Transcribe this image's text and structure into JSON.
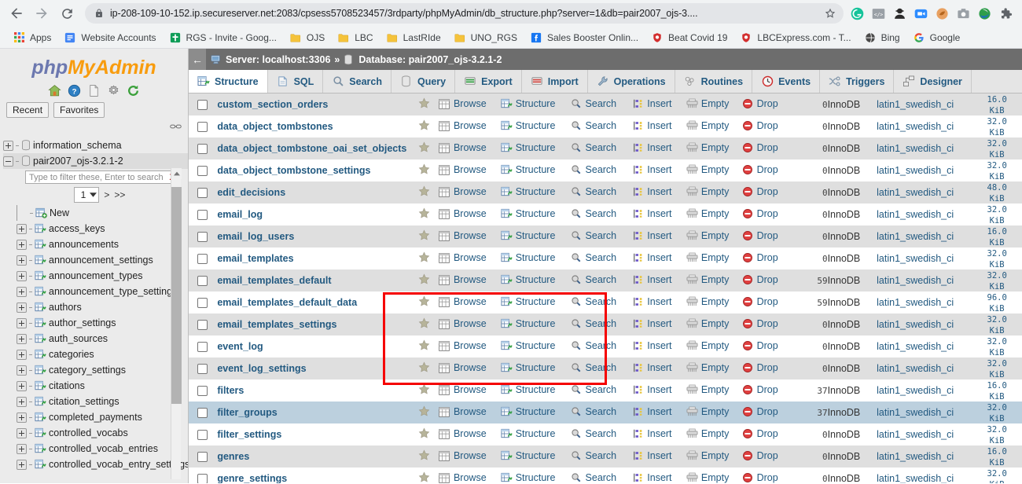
{
  "browser": {
    "nav": {
      "back_icon": "arrow-left-icon",
      "forward_icon": "arrow-right-icon",
      "reload_icon": "reload-icon",
      "lock_icon": "lock-icon",
      "url": "ip-208-109-10-152.ip.secureserver.net:2083/cpsess5708523457/3rdparty/phpMyAdmin/db_structure.php?server=1&db=pair2007_ojs-3....",
      "star_icon": "star-outline-icon"
    },
    "extensions": [
      {
        "name": "grammarly-extension-icon",
        "glyph": "G",
        "color": "#15c39a",
        "shape": "circle"
      },
      {
        "name": "code-extension-icon",
        "glyph": "</>",
        "color": "#9aa0a6",
        "shape": "square"
      },
      {
        "name": "incognito-person-icon",
        "glyph": "♟",
        "color": "#2b2b2b",
        "shape": "none"
      },
      {
        "name": "zoom-extension-icon",
        "glyph": "▶",
        "color": "#2d8cff",
        "shape": "rounded"
      },
      {
        "name": "kiwi-browser-icon",
        "glyph": "●",
        "color": "#e08a3c",
        "shape": "circle"
      },
      {
        "name": "screenshot-camera-icon",
        "glyph": "◎",
        "color": "#9aa0a6",
        "shape": "none"
      },
      {
        "name": "internet-download-manager-icon",
        "glyph": "◕",
        "color": "#2e9e4b",
        "shape": "none"
      },
      {
        "name": "extensions-puzzle-icon",
        "glyph": "❖",
        "color": "#5f6368",
        "shape": "none"
      }
    ],
    "bookmarks": [
      {
        "label": "Apps",
        "icon": "apps-grid-icon",
        "color": "#4285f4"
      },
      {
        "label": "Website Accounts",
        "icon": "google-docs-icon",
        "color": "#4285f4"
      },
      {
        "label": "RGS - Invite - Goog...",
        "icon": "green-cross-icon",
        "color": "#0f9d58"
      },
      {
        "label": "OJS",
        "icon": "folder-icon",
        "color": "#f5c33b"
      },
      {
        "label": "LBC",
        "icon": "folder-icon",
        "color": "#f5c33b"
      },
      {
        "label": "LastRIde",
        "icon": "folder-icon",
        "color": "#f5c33b"
      },
      {
        "label": "UNO_RGS",
        "icon": "folder-icon",
        "color": "#f5c33b"
      },
      {
        "label": "Sales Booster Onlin...",
        "icon": "facebook-icon",
        "color": "#1877f2"
      },
      {
        "label": "Beat Covid 19",
        "icon": "covid-shield-icon",
        "color": "#d32f2f"
      },
      {
        "label": "LBCExpress.com - T...",
        "icon": "covid-shield-icon",
        "color": "#d32f2f"
      },
      {
        "label": "Bing",
        "icon": "bing-globe-icon",
        "color": "#4a4a4a"
      },
      {
        "label": "Google",
        "icon": "google-g-icon",
        "color": "#4285f4"
      }
    ]
  },
  "sidebar": {
    "logo_part1": "php",
    "logo_part2": "MyAdmin",
    "logo_icons": [
      "home-icon",
      "help-icon",
      "docs-icon",
      "settings-gear-icon",
      "reload-refresh-icon"
    ],
    "recent_label": "Recent",
    "favorites_label": "Favorites",
    "chain_icon": "chain-link-icon",
    "databases": [
      {
        "label": "information_schema",
        "expanded": false,
        "selected": false
      },
      {
        "label": "pair2007_ojs-3.2.1-2",
        "expanded": true,
        "selected": true
      }
    ],
    "filter": {
      "placeholder": "Type to filter these, Enter to search",
      "value": "",
      "clear_label": "X"
    },
    "pager": {
      "page": "1",
      "next_label": ">",
      "last_label": ">>"
    },
    "new_label": "New",
    "tables": [
      "access_keys",
      "announcements",
      "announcement_settings",
      "announcement_types",
      "announcement_type_settings",
      "authors",
      "author_settings",
      "auth_sources",
      "categories",
      "category_settings",
      "citations",
      "citation_settings",
      "completed_payments",
      "controlled_vocabs",
      "controlled_vocab_entries",
      "controlled_vocab_entry_settings"
    ]
  },
  "main": {
    "breadcrumb": {
      "back_arrow": "←",
      "server_icon": "server-icon",
      "server_label": "Server: localhost:3306",
      "separator": "»",
      "database_icon": "database-icon",
      "database_label": "Database: pair2007_ojs-3.2.1-2"
    },
    "tabs": [
      {
        "label": "Structure",
        "icon": "structure-icon",
        "active": true
      },
      {
        "label": "SQL",
        "icon": "sql-icon",
        "active": false
      },
      {
        "label": "Search",
        "icon": "search-icon",
        "active": false
      },
      {
        "label": "Query",
        "icon": "query-icon",
        "active": false
      },
      {
        "label": "Export",
        "icon": "export-icon",
        "active": false
      },
      {
        "label": "Import",
        "icon": "import-icon",
        "active": false
      },
      {
        "label": "Operations",
        "icon": "operations-wrench-icon",
        "active": false
      },
      {
        "label": "Routines",
        "icon": "routines-icon",
        "active": false
      },
      {
        "label": "Events",
        "icon": "events-clock-icon",
        "active": false
      },
      {
        "label": "Triggers",
        "icon": "triggers-icon",
        "active": false
      },
      {
        "label": "Designer",
        "icon": "designer-icon",
        "active": false
      }
    ],
    "actions": {
      "browse": "Browse",
      "structure": "Structure",
      "search": "Search",
      "insert": "Insert",
      "empty": "Empty",
      "drop": "Drop"
    },
    "rows": [
      {
        "name": "custom_section_orders",
        "rows": "0",
        "engine": "InnoDB",
        "collation": "latin1_swedish_ci",
        "size": "16.0 KiB",
        "stripe": "r1",
        "hover": false,
        "highlight": false,
        "clipped_top": true
      },
      {
        "name": "data_object_tombstones",
        "rows": "0",
        "engine": "InnoDB",
        "collation": "latin1_swedish_ci",
        "size": "32.0 KiB",
        "stripe": "r0",
        "hover": false,
        "highlight": false
      },
      {
        "name": "data_object_tombstone_oai_set_objects",
        "rows": "0",
        "engine": "InnoDB",
        "collation": "latin1_swedish_ci",
        "size": "32.0 KiB",
        "stripe": "r1",
        "hover": false,
        "highlight": false
      },
      {
        "name": "data_object_tombstone_settings",
        "rows": "0",
        "engine": "InnoDB",
        "collation": "latin1_swedish_ci",
        "size": "32.0 KiB",
        "stripe": "r0",
        "hover": false,
        "highlight": false
      },
      {
        "name": "edit_decisions",
        "rows": "0",
        "engine": "InnoDB",
        "collation": "latin1_swedish_ci",
        "size": "48.0 KiB",
        "stripe": "r1",
        "hover": false,
        "highlight": false
      },
      {
        "name": "email_log",
        "rows": "0",
        "engine": "InnoDB",
        "collation": "latin1_swedish_ci",
        "size": "32.0 KiB",
        "stripe": "r0",
        "hover": false,
        "highlight": false
      },
      {
        "name": "email_log_users",
        "rows": "0",
        "engine": "InnoDB",
        "collation": "latin1_swedish_ci",
        "size": "16.0 KiB",
        "stripe": "r1",
        "hover": false,
        "highlight": false
      },
      {
        "name": "email_templates",
        "rows": "0",
        "engine": "InnoDB",
        "collation": "latin1_swedish_ci",
        "size": "32.0 KiB",
        "stripe": "r0",
        "hover": false,
        "highlight": true
      },
      {
        "name": "email_templates_default",
        "rows": "59",
        "engine": "InnoDB",
        "collation": "latin1_swedish_ci",
        "size": "32.0 KiB",
        "stripe": "r1",
        "hover": false,
        "highlight": true
      },
      {
        "name": "email_templates_default_data",
        "rows": "59",
        "engine": "InnoDB",
        "collation": "latin1_swedish_ci",
        "size": "96.0 KiB",
        "stripe": "r0",
        "hover": false,
        "highlight": true
      },
      {
        "name": "email_templates_settings",
        "rows": "0",
        "engine": "InnoDB",
        "collation": "latin1_swedish_ci",
        "size": "32.0 KiB",
        "stripe": "r1",
        "hover": false,
        "highlight": true
      },
      {
        "name": "event_log",
        "rows": "0",
        "engine": "InnoDB",
        "collation": "latin1_swedish_ci",
        "size": "32.0 KiB",
        "stripe": "r0",
        "hover": false,
        "highlight": false
      },
      {
        "name": "event_log_settings",
        "rows": "0",
        "engine": "InnoDB",
        "collation": "latin1_swedish_ci",
        "size": "32.0 KiB",
        "stripe": "r1",
        "hover": false,
        "highlight": false
      },
      {
        "name": "filters",
        "rows": "37",
        "engine": "InnoDB",
        "collation": "latin1_swedish_ci",
        "size": "16.0 KiB",
        "stripe": "r0",
        "hover": false,
        "highlight": false
      },
      {
        "name": "filter_groups",
        "rows": "37",
        "engine": "InnoDB",
        "collation": "latin1_swedish_ci",
        "size": "32.0 KiB",
        "stripe": "r1",
        "hover": true,
        "highlight": false
      },
      {
        "name": "filter_settings",
        "rows": "0",
        "engine": "InnoDB",
        "collation": "latin1_swedish_ci",
        "size": "32.0 KiB",
        "stripe": "r0",
        "hover": false,
        "highlight": false
      },
      {
        "name": "genres",
        "rows": "0",
        "engine": "InnoDB",
        "collation": "latin1_swedish_ci",
        "size": "16.0 KiB",
        "stripe": "r1",
        "hover": false,
        "highlight": false
      },
      {
        "name": "genre_settings",
        "rows": "0",
        "engine": "InnoDB",
        "collation": "latin1_swedish_ci",
        "size": "32.0 KiB",
        "stripe": "r0",
        "hover": false,
        "highlight": false
      }
    ]
  },
  "annotation": {
    "highlight_color": "#f50000",
    "highlight_tables": [
      "email_templates",
      "email_templates_default",
      "email_templates_default_data",
      "email_templates_settings"
    ]
  }
}
